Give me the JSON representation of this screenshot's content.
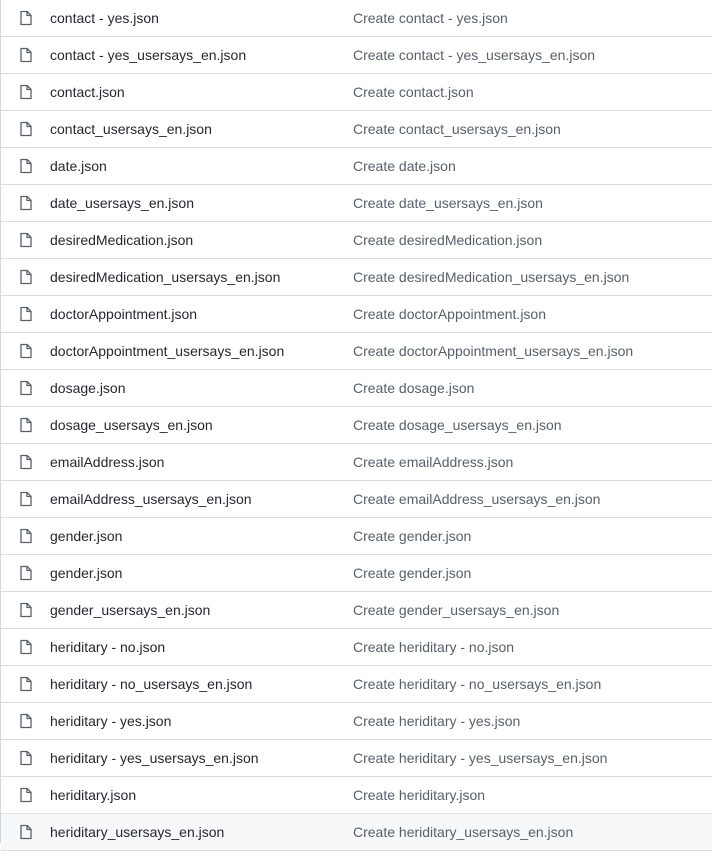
{
  "files": [
    {
      "name": "contact - yes.json",
      "commit": "Create contact - yes.json",
      "icon": "file-icon"
    },
    {
      "name": "contact - yes_usersays_en.json",
      "commit": "Create contact - yes_usersays_en.json",
      "icon": "file-icon"
    },
    {
      "name": "contact.json",
      "commit": "Create contact.json",
      "icon": "file-icon"
    },
    {
      "name": "contact_usersays_en.json",
      "commit": "Create contact_usersays_en.json",
      "icon": "file-icon"
    },
    {
      "name": "date.json",
      "commit": "Create date.json",
      "icon": "file-icon"
    },
    {
      "name": "date_usersays_en.json",
      "commit": "Create date_usersays_en.json",
      "icon": "file-icon"
    },
    {
      "name": "desiredMedication.json",
      "commit": "Create desiredMedication.json",
      "icon": "file-icon"
    },
    {
      "name": "desiredMedication_usersays_en.json",
      "commit": "Create desiredMedication_usersays_en.json",
      "icon": "file-icon"
    },
    {
      "name": "doctorAppointment.json",
      "commit": "Create doctorAppointment.json",
      "icon": "file-icon"
    },
    {
      "name": "doctorAppointment_usersays_en.json",
      "commit": "Create doctorAppointment_usersays_en.json",
      "icon": "file-icon"
    },
    {
      "name": "dosage.json",
      "commit": "Create dosage.json",
      "icon": "file-icon"
    },
    {
      "name": "dosage_usersays_en.json",
      "commit": "Create dosage_usersays_en.json",
      "icon": "file-icon"
    },
    {
      "name": "emailAddress.json",
      "commit": "Create emailAddress.json",
      "icon": "file-icon"
    },
    {
      "name": "emailAddress_usersays_en.json",
      "commit": "Create emailAddress_usersays_en.json",
      "icon": "file-icon"
    },
    {
      "name": "gender.json",
      "commit": "Create gender.json",
      "icon": "file-icon"
    },
    {
      "name": "gender.json",
      "commit": "Create gender.json",
      "icon": "file-icon"
    },
    {
      "name": "gender_usersays_en.json",
      "commit": "Create gender_usersays_en.json",
      "icon": "file-icon"
    },
    {
      "name": "heriditary - no.json",
      "commit": "Create heriditary - no.json",
      "icon": "file-icon"
    },
    {
      "name": "heriditary - no_usersays_en.json",
      "commit": "Create heriditary - no_usersays_en.json",
      "icon": "file-icon"
    },
    {
      "name": "heriditary - yes.json",
      "commit": "Create heriditary - yes.json",
      "icon": "file-icon"
    },
    {
      "name": "heriditary - yes_usersays_en.json",
      "commit": "Create heriditary - yes_usersays_en.json",
      "icon": "file-icon"
    },
    {
      "name": "heriditary.json",
      "commit": "Create heriditary.json",
      "icon": "file-icon"
    },
    {
      "name": "heriditary_usersays_en.json",
      "commit": "Create heriditary_usersays_en.json",
      "icon": "file-icon"
    }
  ],
  "colors": {
    "icon": "#57606a",
    "file_name": "#24292f",
    "commit_message": "#57606a",
    "row_border": "#d8dee4",
    "hover_row": "#f6f8fa"
  }
}
